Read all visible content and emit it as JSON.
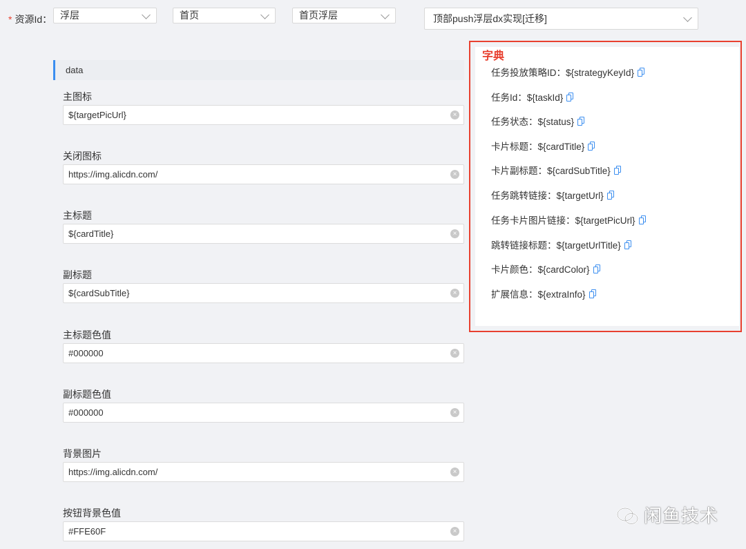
{
  "filter": {
    "label": "资源Id：",
    "required_mark": "*",
    "selects": [
      "浮层",
      "首页",
      "首页浮层",
      "顶部push浮层dx实现[迁移]"
    ]
  },
  "section": {
    "title": "data"
  },
  "fields": [
    {
      "label": "主图标",
      "value": "${targetPicUrl}"
    },
    {
      "label": "关闭图标",
      "value": "https://img.alicdn.com/"
    },
    {
      "label": "主标题",
      "value": "${cardTitle}"
    },
    {
      "label": "副标题",
      "value": "${cardSubTitle}"
    },
    {
      "label": "主标题色值",
      "value": "#000000"
    },
    {
      "label": "副标题色值",
      "value": "#000000"
    },
    {
      "label": "背景图片",
      "value": "https://img.alicdn.com/"
    },
    {
      "label": "按钮背景色值",
      "value": "#FFE60F"
    }
  ],
  "dictionary": {
    "title": "字典",
    "items": [
      "任务投放策略ID：${strategyKeyId}",
      "任务Id：${taskId}",
      "任务状态：${status}",
      "卡片标题：${cardTitle}",
      "卡片副标题：${cardSubTitle}",
      "任务跳转链接：${targetUrl}",
      "任务卡片图片链接：${targetPicUrl}",
      "跳转链接标题：${targetUrlTitle}",
      "卡片颜色：${cardColor}",
      "扩展信息：${extraInfo}"
    ],
    "accent": "#e8402f",
    "copy_icon": "copy-icon"
  },
  "watermark": {
    "text": "闲鱼技术"
  }
}
